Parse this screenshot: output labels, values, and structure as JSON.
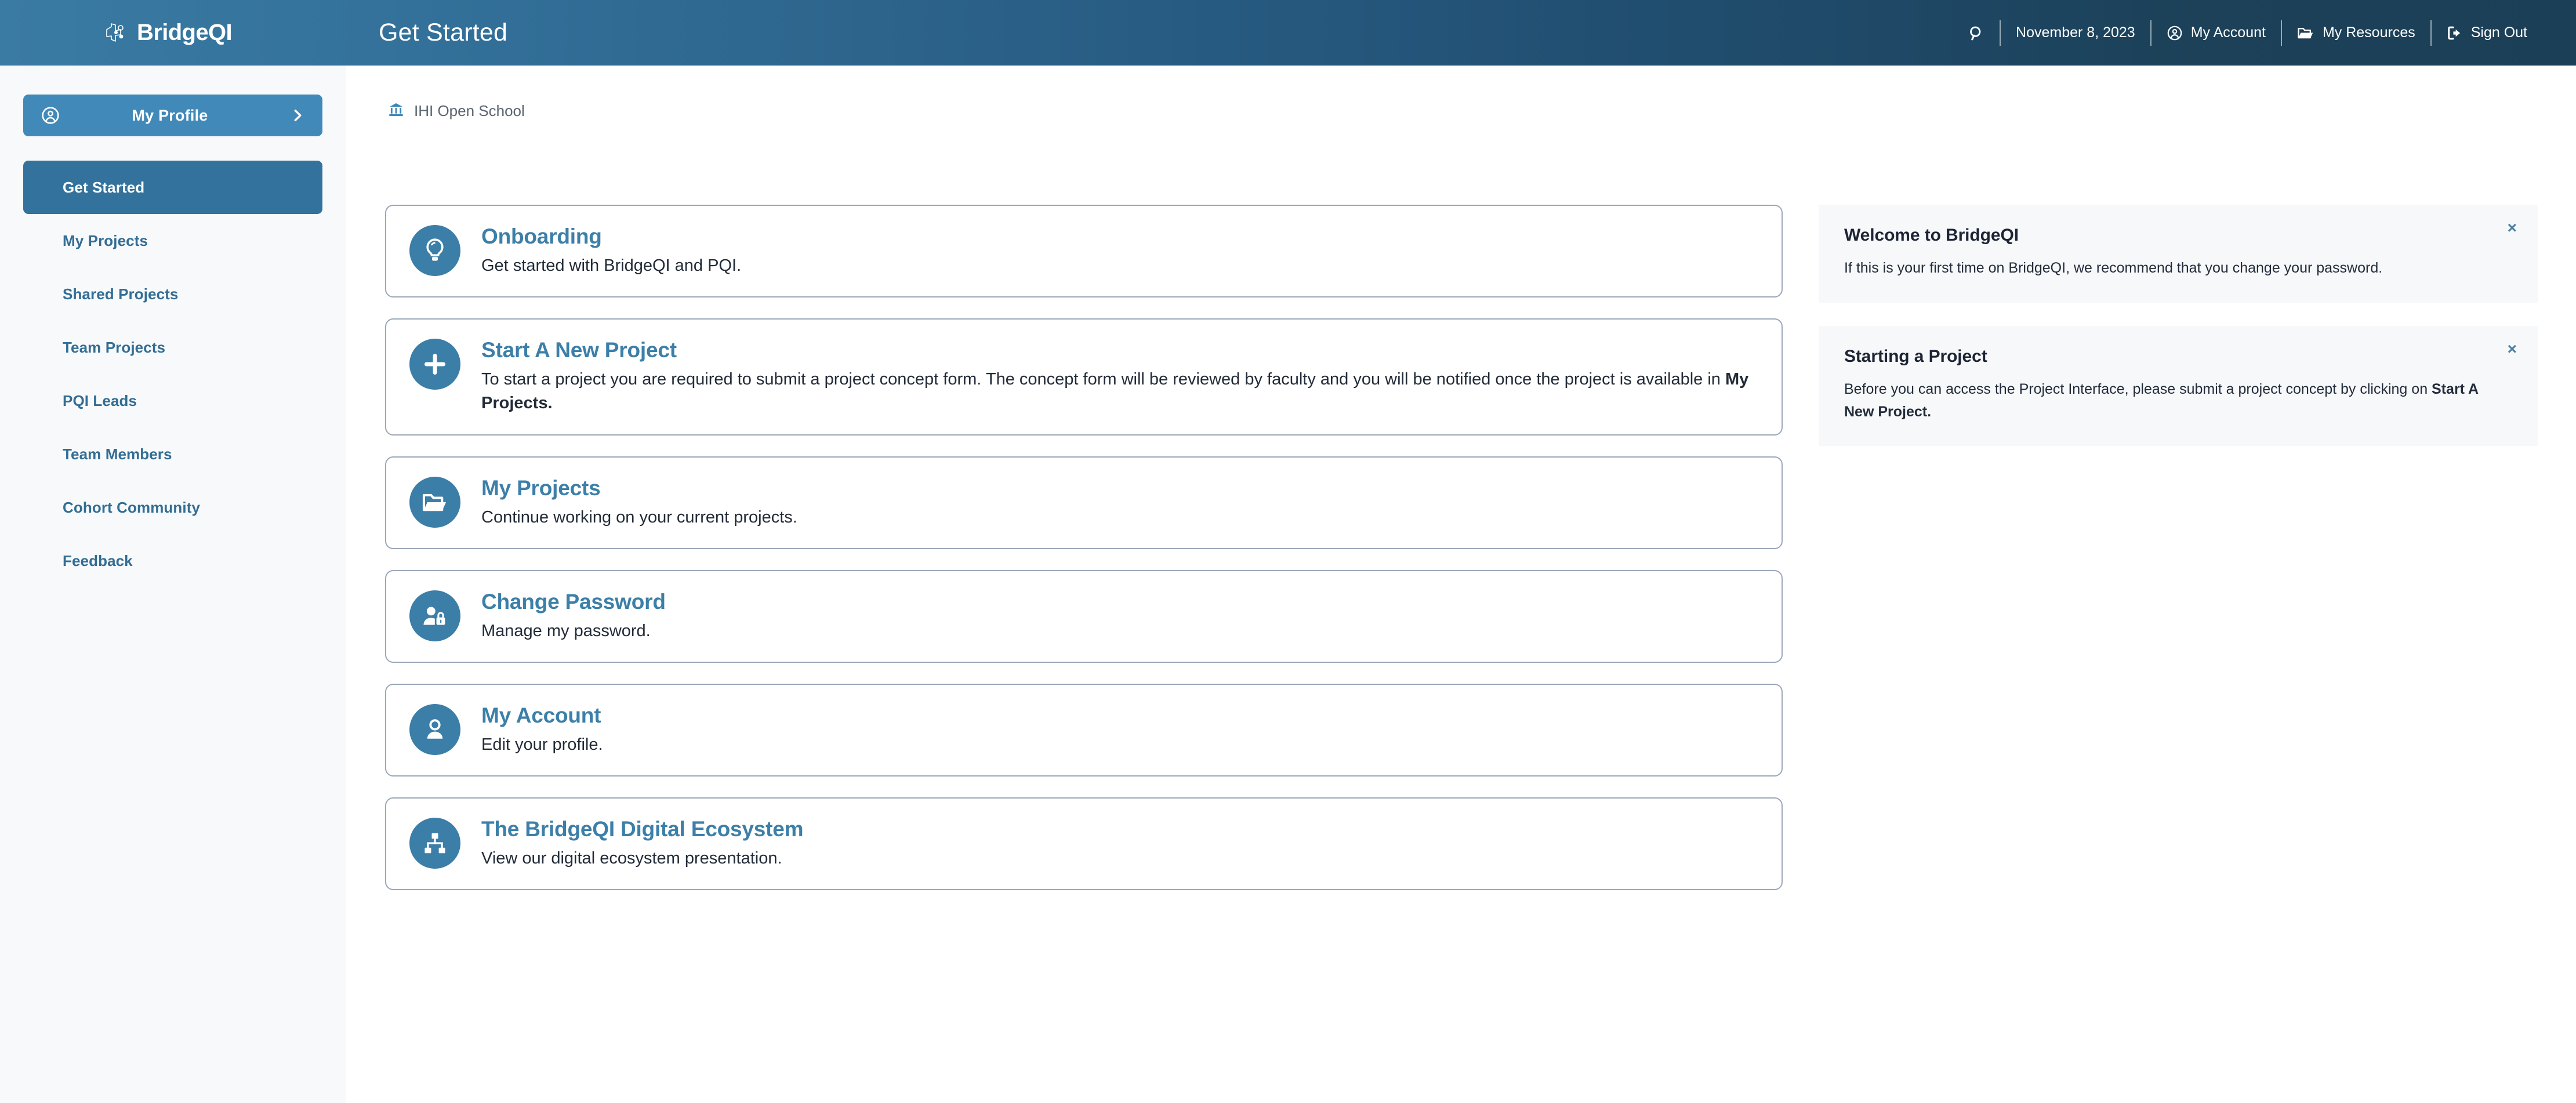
{
  "header": {
    "brand": "BridgeQI",
    "page_title": "Get Started",
    "search_icon": "search-icon",
    "date": "November 8, 2023",
    "account_label": "My Account",
    "resources_label": "My Resources",
    "signout_label": "Sign Out"
  },
  "sidebar": {
    "profile": {
      "label": "My Profile",
      "icon": "user-circle-icon",
      "chevron": "chevron-right-icon"
    },
    "items": [
      {
        "label": "Get Started",
        "active": true
      },
      {
        "label": "My Projects",
        "active": false
      },
      {
        "label": "Shared Projects",
        "active": false
      },
      {
        "label": "Team Projects",
        "active": false
      },
      {
        "label": "PQI Leads",
        "active": false
      },
      {
        "label": "Team Members",
        "active": false
      },
      {
        "label": "Cohort Community",
        "active": false
      },
      {
        "label": "Feedback",
        "active": false
      }
    ]
  },
  "breadcrumb": {
    "icon": "institution-icon",
    "label": "IHI Open School"
  },
  "cards": [
    {
      "icon": "lightbulb-icon",
      "title": "Onboarding",
      "desc_before": "Get started with BridgeQI and PQI.",
      "desc_bold": "",
      "desc_after": ""
    },
    {
      "icon": "plus-icon",
      "title": "Start A New Project",
      "desc_before": "To start a project you are required to submit a project concept form. The concept form will be reviewed by faculty and you will be notified once the project is available in ",
      "desc_bold": "My Projects.",
      "desc_after": ""
    },
    {
      "icon": "folder-open-icon",
      "title": "My Projects",
      "desc_before": "Continue working on your current projects.",
      "desc_bold": "",
      "desc_after": ""
    },
    {
      "icon": "user-lock-icon",
      "title": "Change Password",
      "desc_before": "Manage my password.",
      "desc_bold": "",
      "desc_after": ""
    },
    {
      "icon": "user-icon",
      "title": "My Account",
      "desc_before": "Edit your profile.",
      "desc_bold": "",
      "desc_after": ""
    },
    {
      "icon": "sitemap-icon",
      "title": "The BridgeQI Digital Ecosystem",
      "desc_before": "View our digital ecosystem presentation.",
      "desc_bold": "",
      "desc_after": ""
    }
  ],
  "notifications": [
    {
      "title": "Welcome to BridgeQI",
      "text_before": "If this is your first time on BridgeQI, we recommend that you change your password.",
      "text_bold": "",
      "close": "×"
    },
    {
      "title": "Starting a Project",
      "text_before": "Before you can access the Project Interface, please submit a project concept by clicking on ",
      "text_bold": "Start A New Project.",
      "close": "×"
    }
  ],
  "colors": {
    "header_left": "#3a7ba3",
    "header_right": "#1c4159",
    "accent_blue": "#3c7fa8",
    "active_nav": "#33729c",
    "profile_btn": "#4189b8",
    "card_border": "#9aa8b8",
    "notice_bg": "#f7f8fa",
    "sidebar_bg": "#f7f9fb"
  }
}
